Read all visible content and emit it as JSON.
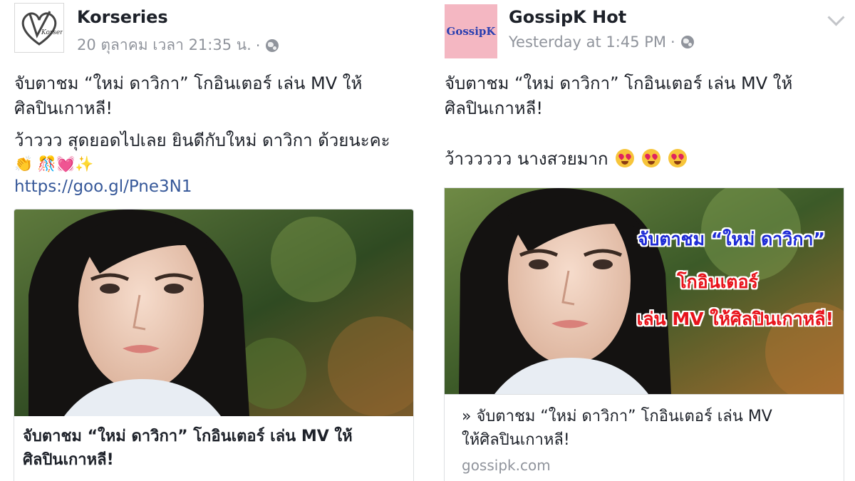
{
  "left_post": {
    "page_name": "Korseries",
    "avatar_text": "Korseries",
    "timestamp": "20 ตุลาคม เวลา 21:35 น.",
    "separator": "·",
    "text_line1": "จับตาชม “ใหม่ ดาวิกา” โกอินเตอร์ เล่น MV ให้",
    "text_line2": "ศิลปินเกาหลี!",
    "text_line3": "ว้าววว สุดยอดไปเลย ยินดีกับใหม่ ดาวิกา ด้วยนะคะ",
    "emoji_line": "👏    🎊💓✨",
    "link": "https://goo.gl/Pne3N1",
    "card_title_line1": "จับตาชม “ใหม่ ดาวิกา” โกอินเตอร์ เล่น MV ให้",
    "card_title_line2": "ศิลปินเกาหลี!"
  },
  "right_post": {
    "page_name": "GossipK Hot",
    "avatar_text": "GossipK",
    "timestamp": "Yesterday at 1:45 PM",
    "separator": "·",
    "text_line1": "จับตาชม “ใหม่ ดาวิกา” โกอินเตอร์ เล่น MV ให้",
    "text_line2": "ศิลปินเกาหลี!",
    "text_line3": "ว้าววววว นางสวยมาก",
    "overlay_line1": "จับตาชม “ใหม่ ดาวิกา”",
    "overlay_line2": "โกอินเตอร์",
    "overlay_line3": "เล่น MV ให้ศิลปินเกาหลี!",
    "card_title_line1": "» จับตาชม “ใหม่ ดาวิกา” โกอินเตอร์ เล่น MV",
    "card_title_line2": "ให้ศิลปินเกาหลี!",
    "card_domain": "gossipk.com"
  },
  "colors": {
    "text": "#1d2129",
    "meta": "#90949c",
    "link": "#365899",
    "overlay_blue": "#1e2bd6",
    "overlay_red": "#e8131b",
    "avatar_pink": "#f4b7c2"
  },
  "icons": [
    "globe-icon",
    "chevron-down-icon",
    "heart-eyes-emoji"
  ]
}
